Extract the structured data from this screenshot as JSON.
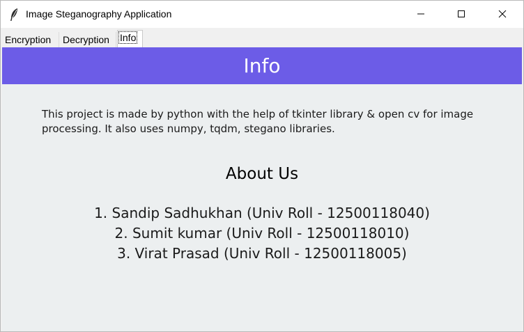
{
  "window": {
    "title": "Image Steganography Application",
    "icons": {
      "app": "feather-icon",
      "minimize": "minimize-icon",
      "maximize": "maximize-icon",
      "close": "close-icon"
    }
  },
  "tabs": [
    {
      "label": "Encryption",
      "active": false
    },
    {
      "label": "Decryption",
      "active": false
    },
    {
      "label": "Info",
      "active": true
    }
  ],
  "info": {
    "header": "Info",
    "description": "This project is made by python with the help of tkinter library & open cv for image processing. It also uses numpy, tqdm, stegano libraries.",
    "about_title": "About Us",
    "members": [
      "1. Sandip Sadhukhan (Univ Roll - 12500118040)",
      "2. Sumit kumar (Univ Roll - 12500118010)",
      "3. Virat Prasad (Univ Roll - 12500118005)"
    ]
  },
  "colors": {
    "header_bg": "#6c5ce7",
    "content_bg": "#eceff0"
  }
}
